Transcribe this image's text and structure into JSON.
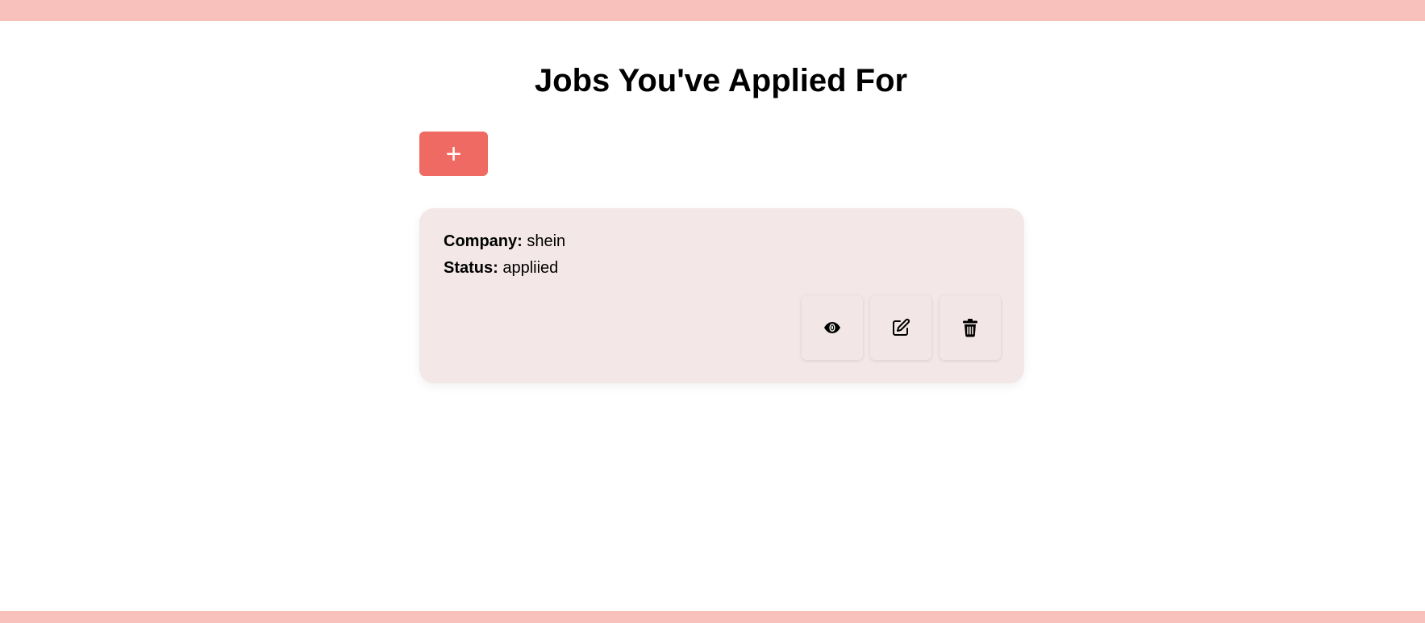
{
  "header": {
    "title": "Jobs You've Applied For"
  },
  "toolbar": {
    "add_label": "+",
    "add_icon": "plus-icon"
  },
  "jobs": [
    {
      "company_label": "Company:",
      "company": "shein",
      "status_label": "Status:",
      "status": "appliied",
      "actions": [
        {
          "icon": "eye-icon"
        },
        {
          "icon": "edit-icon"
        },
        {
          "icon": "trash-icon"
        }
      ]
    }
  ],
  "colors": {
    "accent_bar": "#f9c1bb",
    "add_button": "#ef6a62",
    "card_background": "#f3e8e7"
  }
}
